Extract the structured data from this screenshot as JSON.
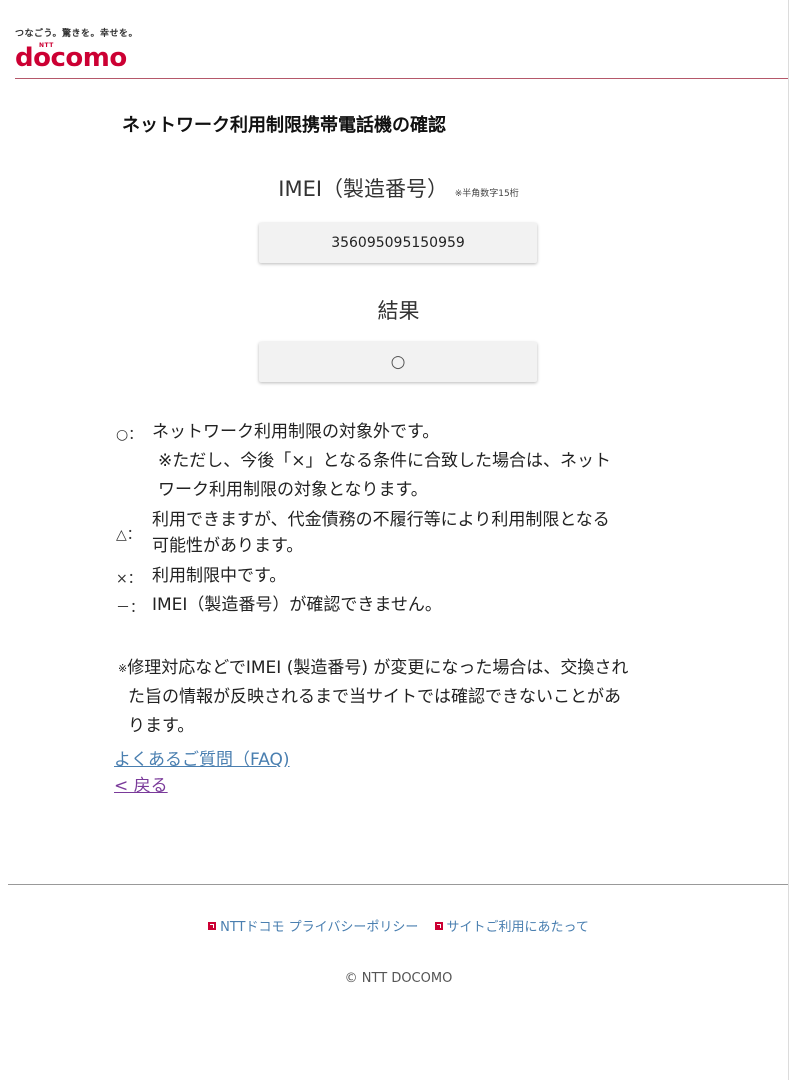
{
  "header": {
    "tagline": "つなごう。驚きを。幸せを。",
    "logo_ntt": "NTT",
    "logo": "docomo",
    "brand_color": "#cc0033"
  },
  "page_title": "ネットワーク利用制限携帯電話機の確認",
  "imei": {
    "label": "IMEI（製造番号）",
    "note": "※半角数字15桁",
    "value": "356095095150959"
  },
  "result": {
    "label": "結果",
    "value": "○"
  },
  "legend": [
    {
      "symbol": "○：",
      "lines": [
        "ネットワーク利用制限の対象外です。",
        "※ただし、今後「×」となる条件に合致した場合は、ネット",
        "ワーク利用制限の対象となります。"
      ]
    },
    {
      "symbol": "△：",
      "lines": [
        "利用できますが、代金債務の不履行等により利用制限となる",
        "可能性があります。"
      ]
    },
    {
      "symbol": "×：",
      "lines": [
        "利用制限中です。"
      ]
    },
    {
      "symbol": "－：",
      "lines": [
        "IMEI（製造番号）が確認できません。"
      ]
    }
  ],
  "footnote": {
    "mark": "※",
    "line1": "修理対応などでIMEI (製造番号) が変更になった場合は、交換され",
    "line2": "た旨の情報が反映されるまで当サイトでは確認できないことがあ",
    "line3": "ります。"
  },
  "links": {
    "faq": "よくあるご質問（FAQ)",
    "back": "< 戻る",
    "faq_color": "#4a7fb0",
    "back_color": "#7a3a9a"
  },
  "footer": {
    "privacy": "NTTドコモ プライバシーポリシー",
    "terms": "サイトご利用にあたって",
    "copyright": "© NTT DOCOMO"
  }
}
